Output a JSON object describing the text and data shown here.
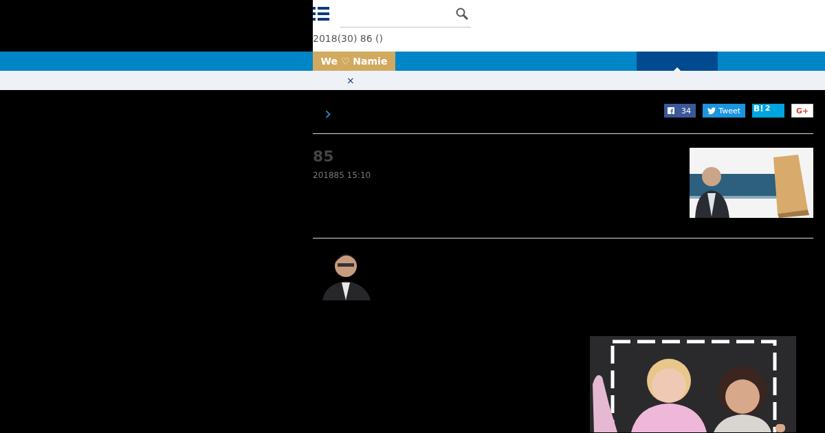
{
  "header": {
    "notice": "2018(30) 86 ()"
  },
  "nav_tabs": [
    {
      "kind": "feature",
      "label": "We ♡ Namie",
      "selected": false
    },
    {
      "kind": "section",
      "selected": true
    }
  ],
  "notice_bar": {
    "close": "×"
  },
  "breadcrumb": {
    "arrow": "›"
  },
  "share": [
    {
      "kind": "facebook",
      "count": "34"
    },
    {
      "kind": "twitter",
      "label": "Tweet"
    },
    {
      "kind": "hatena",
      "label": "B!",
      "count": "2"
    },
    {
      "kind": "gplus",
      "label": "G+"
    }
  ],
  "article": {
    "title": "85",
    "date": "201885 15:10"
  }
}
